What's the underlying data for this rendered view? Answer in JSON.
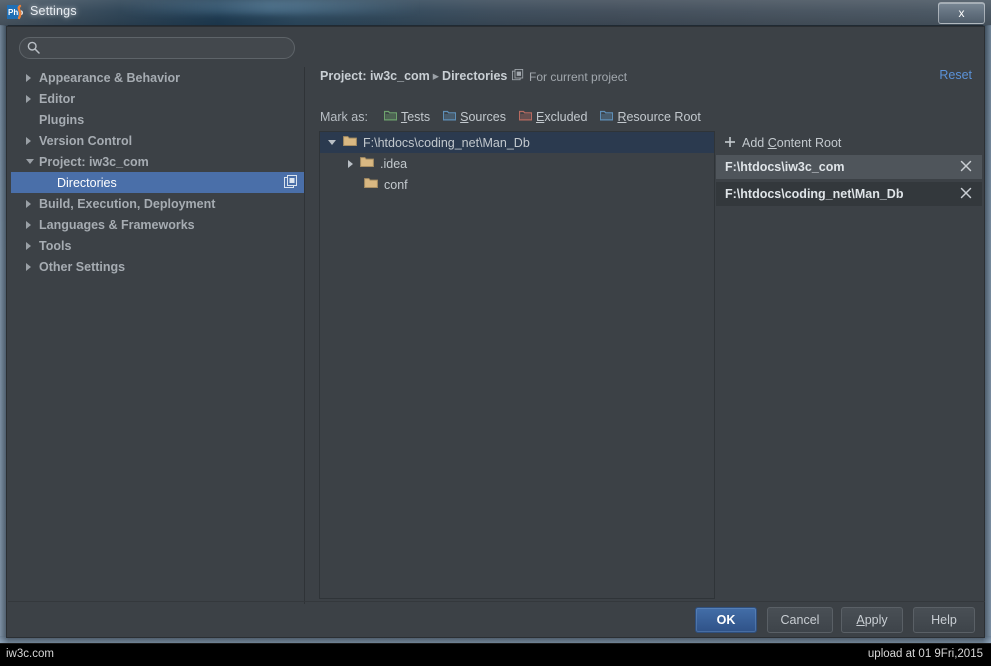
{
  "window": {
    "title": "Settings",
    "app_icon": "phpstorm-icon",
    "close_label": "x"
  },
  "search": {
    "placeholder": "",
    "value": "",
    "icon": "search-icon"
  },
  "sidebar": {
    "items": [
      {
        "label": "Appearance & Behavior",
        "level": 1,
        "arrow": "collapsed",
        "selected": false
      },
      {
        "label": "Editor",
        "level": 1,
        "arrow": "collapsed",
        "selected": false
      },
      {
        "label": "Plugins",
        "level": 1,
        "arrow": "none",
        "selected": false
      },
      {
        "label": "Version Control",
        "level": 1,
        "arrow": "collapsed",
        "selected": false
      },
      {
        "label": "Project: iw3c_com",
        "level": 1,
        "arrow": "expanded",
        "selected": false
      },
      {
        "label": "Directories",
        "level": 2,
        "arrow": "none",
        "selected": true,
        "badge": "project-scope-icon"
      },
      {
        "label": "Build, Execution, Deployment",
        "level": 1,
        "arrow": "collapsed",
        "selected": false
      },
      {
        "label": "Languages & Frameworks",
        "level": 1,
        "arrow": "collapsed",
        "selected": false
      },
      {
        "label": "Tools",
        "level": 1,
        "arrow": "collapsed",
        "selected": false
      },
      {
        "label": "Other Settings",
        "level": 1,
        "arrow": "collapsed",
        "selected": false
      }
    ]
  },
  "content": {
    "breadcrumb": {
      "root": "Project: iw3c_com",
      "separator": "▸",
      "leaf": "Directories"
    },
    "scope_note": {
      "icon": "project-scope-icon",
      "text": "For current project"
    },
    "reset_label": "Reset",
    "mark_as": {
      "label": "Mark as:",
      "buttons": [
        {
          "mnemonic": "T",
          "rest": "ests",
          "color": "#6ea36e",
          "icon": "folder-icon-green"
        },
        {
          "mnemonic": "S",
          "rest": "ources",
          "color": "#5e8fb8",
          "icon": "folder-icon-blue"
        },
        {
          "mnemonic": "E",
          "rest": "xcluded",
          "color": "#b86a60",
          "icon": "folder-icon-red"
        },
        {
          "mnemonic": "R",
          "rest": "esource Root",
          "color": "#5e8fb8",
          "icon": "folder-icon-blue"
        }
      ]
    },
    "file_tree": [
      {
        "label": "F:\\htdocs\\coding_net\\Man_Db",
        "indent": 0,
        "arrow": "expanded",
        "selected": true,
        "icon": "folder-icon-tan"
      },
      {
        "label": ".idea",
        "indent": 1,
        "arrow": "collapsed",
        "selected": false,
        "icon": "folder-icon-tan"
      },
      {
        "label": "conf",
        "indent": 1,
        "arrow": "none",
        "selected": false,
        "icon": "folder-icon-tan"
      }
    ],
    "content_roots": {
      "add_button": {
        "icon": "plus-icon",
        "prefix": "Add ",
        "mnemonic": "C",
        "rest": "ontent Root"
      },
      "rows": [
        {
          "path": "F:\\htdocs\\iw3c_com",
          "style": "light",
          "close_icon": "close-icon"
        },
        {
          "path": "F:\\htdocs\\coding_net\\Man_Db",
          "style": "dark",
          "close_icon": "close-icon"
        }
      ]
    }
  },
  "buttons": {
    "ok": {
      "label": "OK",
      "primary": true
    },
    "cancel": {
      "label": "Cancel",
      "primary": false
    },
    "apply": {
      "mnemonic": "A",
      "rest": "pply",
      "primary": false
    },
    "help": {
      "label": "Help",
      "primary": false
    }
  },
  "footer": {
    "left": "iw3c.com",
    "right": "upload at 01 9Fri,2015"
  },
  "colors": {
    "dialog_bg": "#3c4146",
    "selection_blue": "#4a6fa9",
    "tree_selection": "#2b3a4f",
    "accent_link": "#5b92d8",
    "primary_button": "#436ea8"
  }
}
